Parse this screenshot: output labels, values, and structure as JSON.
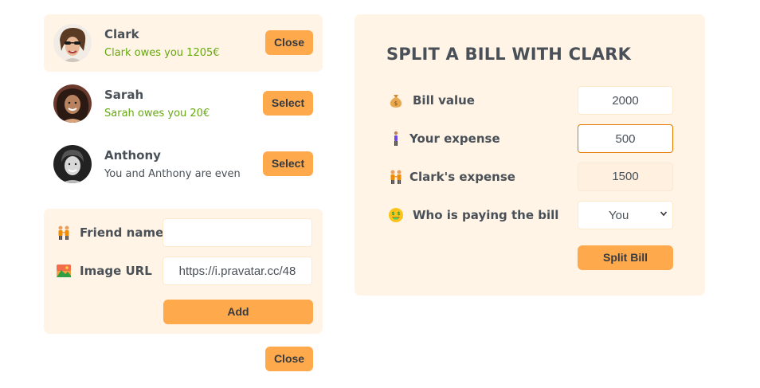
{
  "friends": [
    {
      "name": "Clark",
      "status": "Clark owes you 1205€",
      "button": "Close",
      "selected": true
    },
    {
      "name": "Sarah",
      "status": "Sarah owes you 20€",
      "button": "Select",
      "selected": false
    },
    {
      "name": "Anthony",
      "status": "You and Anthony are even",
      "button": "Select",
      "selected": false
    }
  ],
  "add_form": {
    "friend_name_label": "Friend name",
    "friend_name_value": "",
    "image_url_label": "Image URL",
    "image_url_value": "https://i.pravatar.cc/48",
    "add_button": "Add"
  },
  "close_button": "Close",
  "split": {
    "title": "SPLIT A BILL WITH CLARK",
    "bill_value_label": "Bill value",
    "bill_value": "2000",
    "your_expense_label": "Your expense",
    "your_expense": "500",
    "friend_expense_label": "Clark's expense",
    "friend_expense": "1500",
    "payer_label": "Who is paying the bill",
    "payer_selected": "You",
    "split_button": "Split Bill"
  },
  "colors": {
    "accent": "#ffa94d",
    "panel_bg": "#fff4e6",
    "positive": "#66a80f",
    "text": "#495057"
  },
  "icons": {
    "bill_value": "money-bag-icon",
    "your_expense": "person-standing-icon",
    "friend_expense": "people-holding-hands-icon",
    "payer": "money-mouth-face-icon",
    "friend_name": "people-holding-hands-icon",
    "image_url": "picture-icon"
  }
}
